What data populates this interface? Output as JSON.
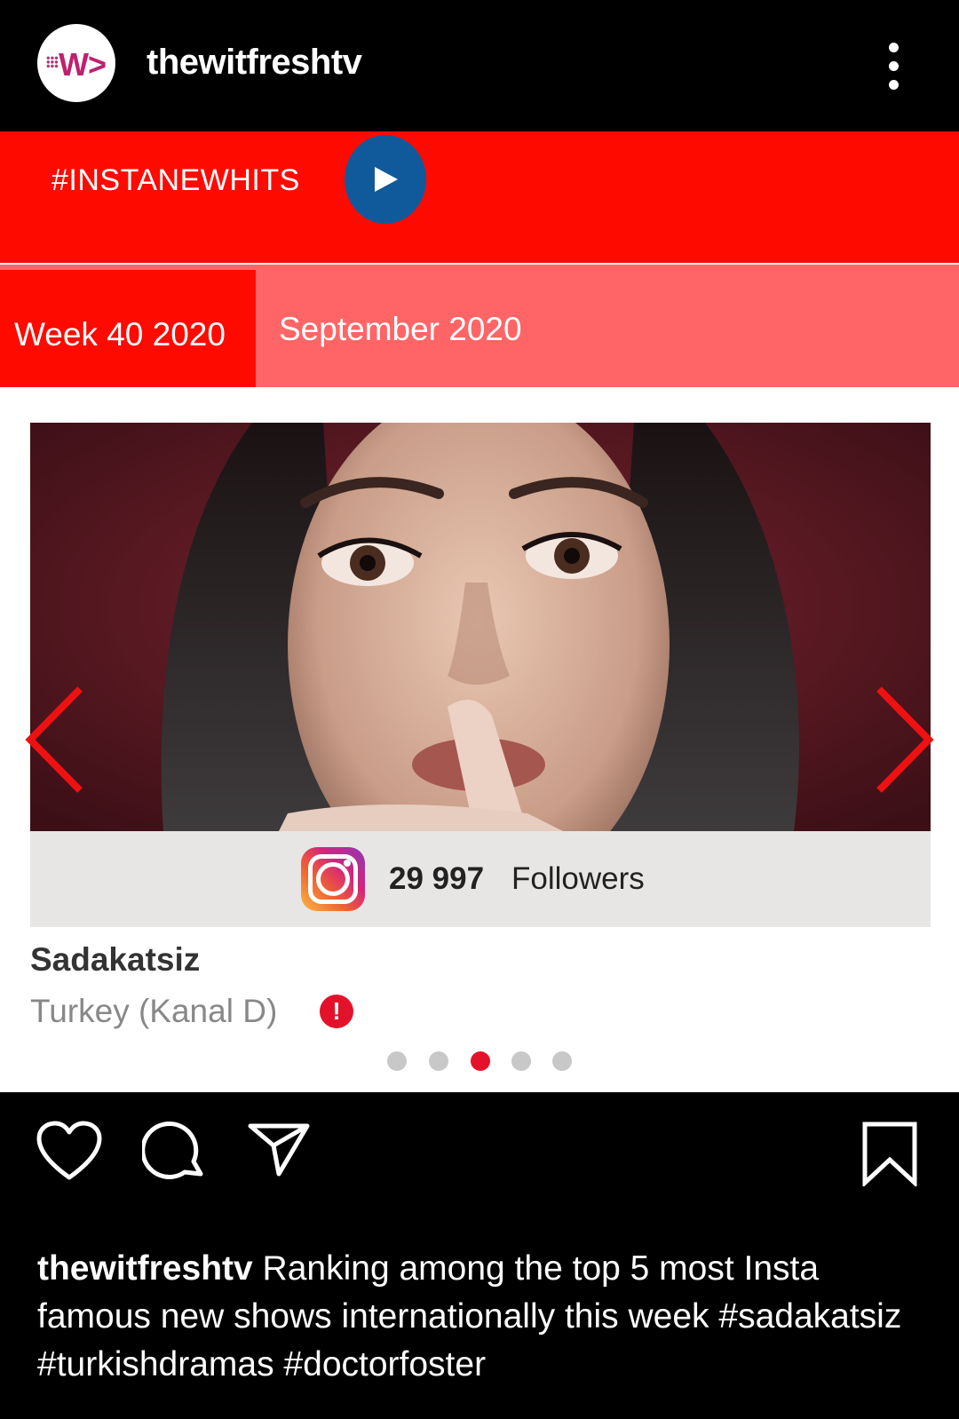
{
  "header": {
    "handle": "thewitfreshtv",
    "avatar_text": "W>"
  },
  "banner": {
    "hashtag": "#INSTANEWHITS",
    "play_icon": "play-icon"
  },
  "tabs": {
    "week": "Week 40 2020",
    "month": "September 2020"
  },
  "card": {
    "followers_count": "29 997",
    "followers_label": "Followers",
    "show_title": "Sadakatsiz",
    "show_subtitle": "Turkey (Kanal D)",
    "warn_icon_text": "!"
  },
  "carousel": {
    "dot_count": 5,
    "active_index": 2
  },
  "caption": {
    "handle": "thewitfreshtv",
    "text": "Ranking among the top 5 most Insta famous new shows internationally this week #sadakatsiz #turkishdramas #doctorfoster"
  },
  "colors": {
    "banner_red": "#ff0a00",
    "tab_light_red": "#ff6566",
    "play_blue": "#105a9c",
    "active_dot": "#e3122a",
    "background": "#000000"
  }
}
